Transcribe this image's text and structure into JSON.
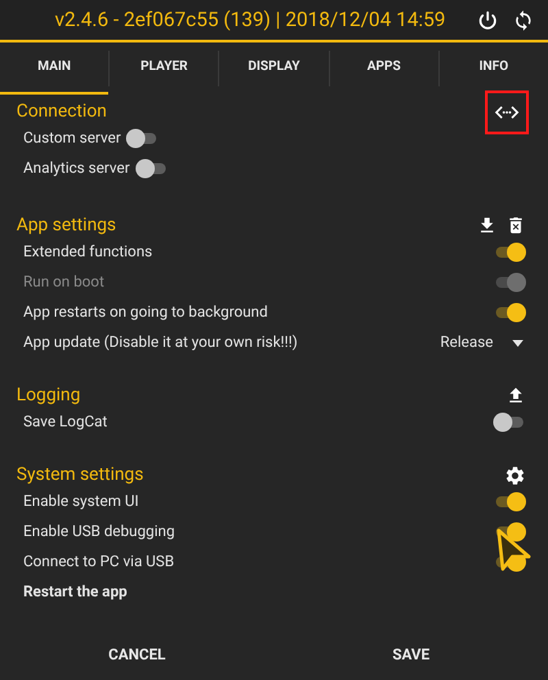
{
  "header": {
    "title": "v2.4.6 - 2ef067c55 (139) | 2018/12/04 14:59"
  },
  "tabs": [
    {
      "label": "MAIN",
      "selected": true
    },
    {
      "label": "PLAYER",
      "selected": false
    },
    {
      "label": "DISPLAY",
      "selected": false
    },
    {
      "label": "APPS",
      "selected": false
    },
    {
      "label": "INFO",
      "selected": false
    }
  ],
  "sections": [
    {
      "title": "Connection",
      "actions": [
        {
          "kind": "code",
          "highlighted": true
        }
      ],
      "rows": [
        {
          "kind": "switch-inline",
          "label": "Custom server",
          "on": false,
          "disabled": false
        },
        {
          "kind": "switch-inline",
          "label": "Analytics server",
          "on": false,
          "disabled": false
        }
      ]
    },
    {
      "title": "App settings",
      "actions": [
        {
          "kind": "download",
          "highlighted": false
        },
        {
          "kind": "delete",
          "highlighted": false
        }
      ],
      "rows": [
        {
          "kind": "switch",
          "label": "Extended functions",
          "on": true,
          "disabled": false
        },
        {
          "kind": "switch",
          "label": "Run on boot",
          "on": true,
          "disabled": true
        },
        {
          "kind": "switch",
          "label": "App restarts on going to background",
          "on": true,
          "disabled": false
        },
        {
          "kind": "select",
          "label": "App update (Disable it at your own risk!!!)",
          "value": "Release"
        }
      ]
    },
    {
      "title": "Logging",
      "actions": [
        {
          "kind": "upload",
          "highlighted": false
        }
      ],
      "rows": [
        {
          "kind": "switch",
          "label": "Save LogCat",
          "on": false,
          "disabled": false
        }
      ]
    },
    {
      "title": "System settings",
      "actions": [
        {
          "kind": "settings",
          "highlighted": false
        }
      ],
      "rows": [
        {
          "kind": "switch",
          "label": "Enable system UI",
          "on": true,
          "disabled": false
        },
        {
          "kind": "switch",
          "label": "Enable USB debugging",
          "on": true,
          "disabled": false
        },
        {
          "kind": "switch",
          "label": "Connect to PC via USB",
          "on": true,
          "disabled": false
        },
        {
          "kind": "action",
          "label": "Restart the app"
        }
      ]
    }
  ],
  "buttons": [
    "CANCEL",
    "SAVE"
  ]
}
